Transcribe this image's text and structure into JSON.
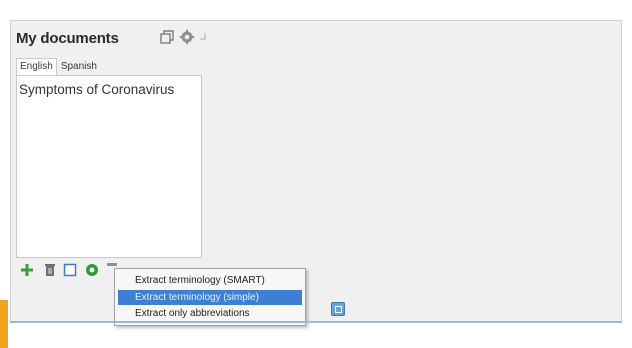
{
  "panel": {
    "title": "My documents"
  },
  "icons": {
    "restore": "window-restore-icon",
    "settings": "gear-icon",
    "pin": "pin-icon",
    "add": "plus-icon",
    "delete": "trash-icon",
    "select": "checkbox-icon",
    "refresh": "green-circle-icon",
    "more": "menu-icon"
  },
  "tabs": [
    {
      "label": "English"
    },
    {
      "label": "Spanish"
    }
  ],
  "documents": [
    {
      "name": "Symptoms of Coronavirus"
    }
  ],
  "context_menu": {
    "items": [
      {
        "label": "Extract terminology (SMART)"
      },
      {
        "label": "Extract terminology (simple)"
      },
      {
        "label": "Extract only abbreviations"
      }
    ]
  },
  "colors": {
    "accent": "#3d7fd1",
    "add": "#3a9e3a",
    "refresh": "#2e9a37",
    "orange": "#f3a21e"
  }
}
